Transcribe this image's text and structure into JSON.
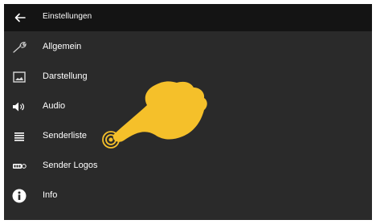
{
  "header": {
    "title": "Einstellungen",
    "back_icon": "arrow-left-icon"
  },
  "menu": {
    "items": [
      {
        "label": "Allgemein",
        "icon": "wrench-icon"
      },
      {
        "label": "Darstellung",
        "icon": "image-icon"
      },
      {
        "label": "Audio",
        "icon": "speaker-icon"
      },
      {
        "label": "Senderliste",
        "icon": "list-icon"
      },
      {
        "label": "Sender Logos",
        "icon": "logo-badge-icon"
      },
      {
        "label": "Info",
        "icon": "info-icon"
      }
    ]
  },
  "colors": {
    "background": "#2a2a2a",
    "header": "#141414",
    "text": "#ffffff",
    "icon": "#d8d8d8",
    "pointer_hand": "#f5c02a"
  }
}
